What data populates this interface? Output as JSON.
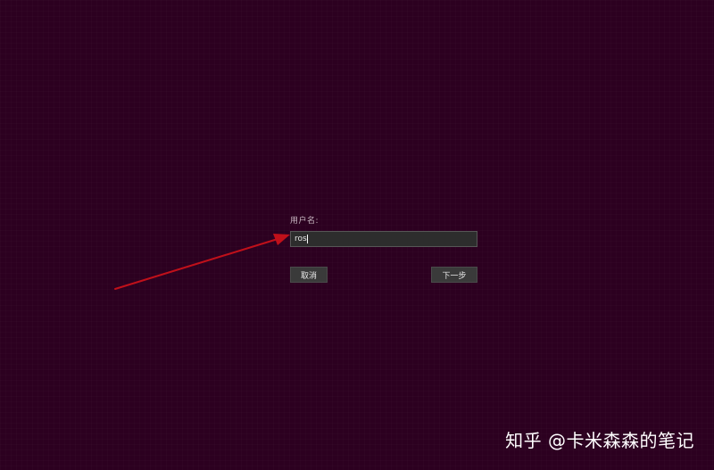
{
  "login": {
    "username_label": "用户名:",
    "username_value": "ros",
    "cancel_label": "取消",
    "next_label": "下一步"
  },
  "annotation": {
    "arrow_color": "#c0101a"
  },
  "watermark": {
    "text": "知乎 @卡米森森的笔记"
  },
  "colors": {
    "background": "#2c0020"
  }
}
